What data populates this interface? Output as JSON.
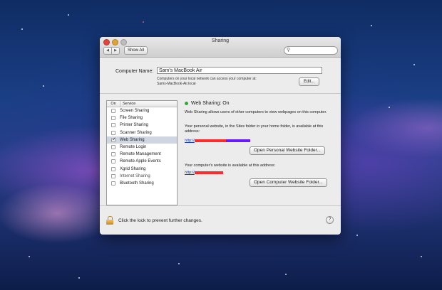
{
  "window": {
    "title": "Sharing"
  },
  "toolbar": {
    "back": "◀",
    "forward": "▶",
    "show_all": "Show All",
    "search_placeholder": ""
  },
  "computer": {
    "label": "Computer Name:",
    "value": "Sam's MacBook Air",
    "desc_line1": "Computers on your local network can access your computer at:",
    "desc_line2": "Sams-MacBook-Air.local",
    "edit_label": "Edit..."
  },
  "services": {
    "header_on": "On",
    "header_service": "Service",
    "items": [
      {
        "label": "Screen Sharing",
        "checked": false
      },
      {
        "label": "File Sharing",
        "checked": false
      },
      {
        "label": "Printer Sharing",
        "checked": false
      },
      {
        "label": "Scanner Sharing",
        "checked": false
      },
      {
        "label": "Web Sharing",
        "checked": true,
        "selected": true
      },
      {
        "label": "Remote Login",
        "checked": false
      },
      {
        "label": "Remote Management",
        "checked": false
      },
      {
        "label": "Remote Apple Events",
        "checked": false
      },
      {
        "label": "Xgrid Sharing",
        "checked": false
      },
      {
        "label": "Internet Sharing",
        "checked": false
      },
      {
        "label": "Bluetooth Sharing",
        "checked": false
      }
    ]
  },
  "detail": {
    "status": "Web Sharing: On",
    "status_color": "#2eae2e",
    "intro": "Web Sharing allows users of other computers to view webpages on this computer.",
    "personal_text": "Your personal website, in the Sites folder in your home folder, is available at this address:",
    "personal_link_prefix": "http://",
    "open_personal_label": "Open Personal Website Folder...",
    "computer_text": "Your computer's website is available at this address:",
    "computer_link_prefix": "http://",
    "open_computer_label": "Open Computer Website Folder..."
  },
  "footer": {
    "lock_text": "Click the lock to prevent further changes.",
    "help": "?"
  }
}
